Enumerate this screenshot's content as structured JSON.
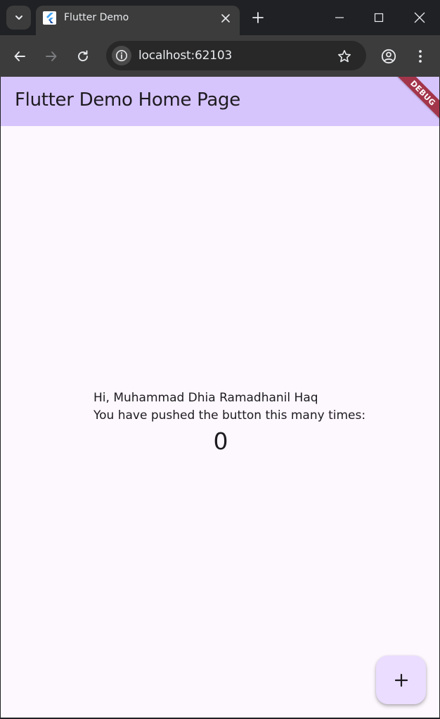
{
  "browser": {
    "tab": {
      "title": "Flutter Demo"
    },
    "address_bar": {
      "url": "localhost:62103"
    }
  },
  "app": {
    "appbar_title": "Flutter Demo Home Page",
    "debug_banner": "DEBUG",
    "greeting": "Hi, Muhammad Dhia Ramadhanil Haq",
    "push_label": "You have pushed the button this many times:",
    "counter": "0"
  },
  "colors": {
    "appbar_bg": "#d6c4fc",
    "surface": "#fdf7fe",
    "fab_bg": "#eaddff",
    "debug_banner": "#a3354a",
    "chrome_dark": "#202124"
  },
  "icons": {
    "tab_search": "chevron-down-icon",
    "favicon": "flutter-logo-icon",
    "tab_close": "close-icon",
    "new_tab": "plus-icon",
    "minimize": "minimize-icon",
    "maximize": "maximize-icon",
    "window_close": "close-icon",
    "back": "arrow-left-icon",
    "forward": "arrow-right-icon",
    "reload": "reload-icon",
    "site_info": "info-icon",
    "bookmark": "star-icon",
    "profile": "profile-icon",
    "menu": "more-vertical-icon",
    "fab": "plus-icon"
  }
}
